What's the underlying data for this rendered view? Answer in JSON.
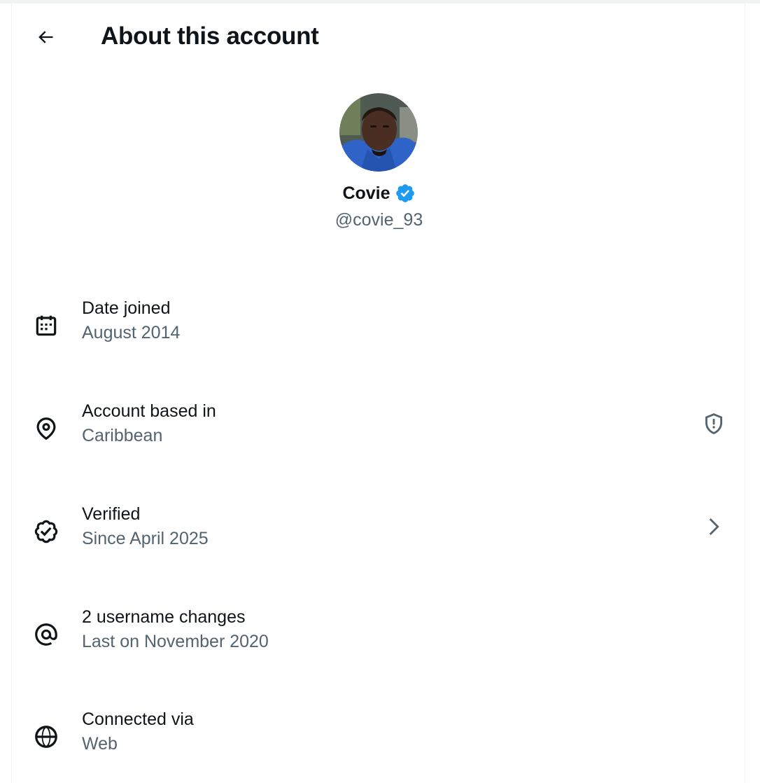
{
  "header": {
    "back_icon": "arrow-left-icon",
    "title": "About this account"
  },
  "profile": {
    "display_name": "Covie",
    "handle": "@covie_93",
    "verified_badge_icon": "verified-badge-icon",
    "verified_badge_color": "#1d9bf0"
  },
  "rows": [
    {
      "icon": "calendar-icon",
      "label": "Date joined",
      "value": "August 2014"
    },
    {
      "icon": "location-pin-icon",
      "label": "Account based in",
      "value": "Caribbean",
      "trailing_icon": "shield-alert-icon"
    },
    {
      "icon": "verified-check-icon",
      "label": "Verified",
      "value": "Since April 2025",
      "trailing_icon": "chevron-right-icon"
    },
    {
      "icon": "at-sign-icon",
      "label": "2 username changes",
      "value": "Last on November 2020"
    },
    {
      "icon": "globe-icon",
      "label": "Connected via",
      "value": "Web"
    }
  ],
  "colors": {
    "primary_text": "#0f1419",
    "secondary_text": "#536471",
    "divider": "#eff3f4",
    "accent": "#1d9bf0"
  }
}
